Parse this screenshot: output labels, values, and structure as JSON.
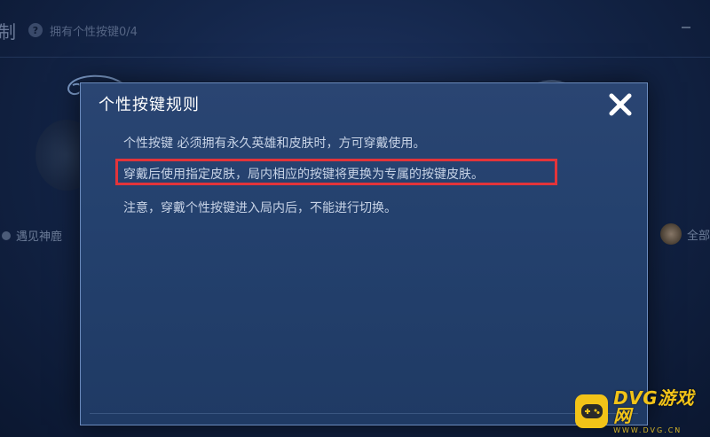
{
  "background": {
    "title_fragment": "制",
    "help_icon": "question-mark-icon",
    "help_icon_glyph": "?",
    "owned_count_text": "拥有个性按键0/4",
    "left_item_label": "遇见神鹿",
    "right_item_label": "全部"
  },
  "dialog": {
    "title": "个性按键规则",
    "close_icon": "close-x-icon",
    "rules": [
      "个性按键 必须拥有永久英雄和皮肤时，方可穿戴使用。",
      "穿戴后使用指定皮肤，局内相应的按键将更换为专属的按键皮肤。",
      "注意，穿戴个性按键进入局内后，不能进行切换。"
    ],
    "highlighted_rule_index": 1
  },
  "watermark": {
    "name": "DVG游戏网",
    "domain": "WWW.DVG.CN",
    "logo_icon": "gamepad-icon"
  },
  "colors": {
    "dialog_bg": "#24416e",
    "dialog_border": "#6b8bbd",
    "highlight": "#e3343a",
    "rule_text": "#c7d3e6",
    "watermark_yellow": "#f2c318"
  }
}
